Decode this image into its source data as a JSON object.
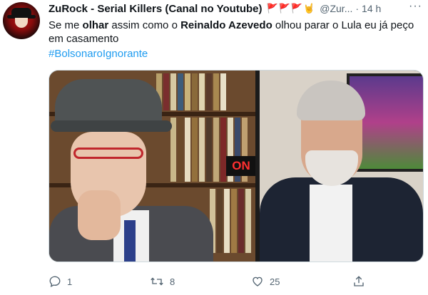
{
  "tweet": {
    "author_name": "ZuRock - Serial Killers (Canal no Youtube)",
    "author_flags": "🚩🚩🚩🤘",
    "handle": "@Zur...",
    "time": "14 h",
    "more": "···",
    "text_parts": [
      "Se me ",
      "olhar",
      " assim  como o ",
      "Reinaldo Azevedo",
      " olhou parar o Lula eu já peço em casamento"
    ],
    "hashtag": "#BolsonaroIgnorante",
    "media": {
      "sign_text": "ON"
    }
  },
  "actions": {
    "reply_count": "1",
    "retweet_count": "8",
    "like_count": "25"
  },
  "icons": {
    "reply": "reply-icon",
    "retweet": "retweet-icon",
    "like": "heart-icon",
    "share": "share-icon",
    "more": "more-icon"
  },
  "colors": {
    "link": "#1d9bf0",
    "muted": "#536471",
    "flag": "#e0245e"
  }
}
